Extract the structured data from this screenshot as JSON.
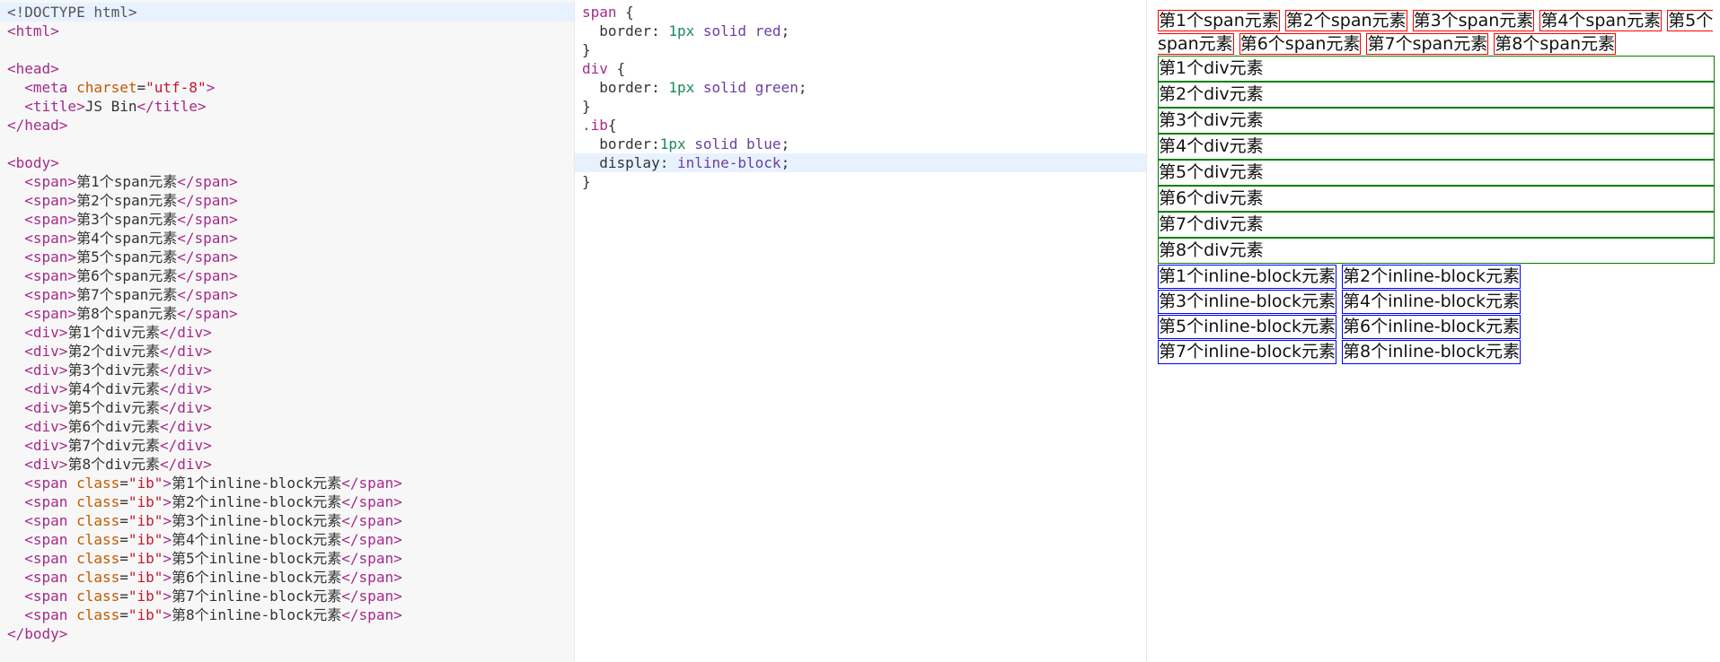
{
  "html_lines": [
    [
      [
        "c-doc",
        "<!DOCTYPE html>"
      ]
    ],
    [
      [
        "c-tag",
        "<html>"
      ]
    ],
    [],
    [
      [
        "c-tag",
        "<head>"
      ]
    ],
    [
      [
        "c-txt",
        "  "
      ],
      [
        "c-tag",
        "<meta "
      ],
      [
        "c-attr",
        "charset"
      ],
      [
        "c-txt",
        "="
      ],
      [
        "c-str",
        "\"utf-8\""
      ],
      [
        "c-tag",
        ">"
      ]
    ],
    [
      [
        "c-txt",
        "  "
      ],
      [
        "c-tag",
        "<title>"
      ],
      [
        "c-txt",
        "JS Bin"
      ],
      [
        "c-tag",
        "</title>"
      ]
    ],
    [
      [
        "c-tag",
        "</head>"
      ]
    ],
    [],
    [
      [
        "c-tag",
        "<body>"
      ]
    ],
    [
      [
        "c-txt",
        "  "
      ],
      [
        "c-tag",
        "<span>"
      ],
      [
        "c-txt",
        "第1个span元素"
      ],
      [
        "c-tag",
        "</span>"
      ]
    ],
    [
      [
        "c-txt",
        "  "
      ],
      [
        "c-tag",
        "<span>"
      ],
      [
        "c-txt",
        "第2个span元素"
      ],
      [
        "c-tag",
        "</span>"
      ]
    ],
    [
      [
        "c-txt",
        "  "
      ],
      [
        "c-tag",
        "<span>"
      ],
      [
        "c-txt",
        "第3个span元素"
      ],
      [
        "c-tag",
        "</span>"
      ]
    ],
    [
      [
        "c-txt",
        "  "
      ],
      [
        "c-tag",
        "<span>"
      ],
      [
        "c-txt",
        "第4个span元素"
      ],
      [
        "c-tag",
        "</span>"
      ]
    ],
    [
      [
        "c-txt",
        "  "
      ],
      [
        "c-tag",
        "<span>"
      ],
      [
        "c-txt",
        "第5个span元素"
      ],
      [
        "c-tag",
        "</span>"
      ]
    ],
    [
      [
        "c-txt",
        "  "
      ],
      [
        "c-tag",
        "<span>"
      ],
      [
        "c-txt",
        "第6个span元素"
      ],
      [
        "c-tag",
        "</span>"
      ]
    ],
    [
      [
        "c-txt",
        "  "
      ],
      [
        "c-tag",
        "<span>"
      ],
      [
        "c-txt",
        "第7个span元素"
      ],
      [
        "c-tag",
        "</span>"
      ]
    ],
    [
      [
        "c-txt",
        "  "
      ],
      [
        "c-tag",
        "<span>"
      ],
      [
        "c-txt",
        "第8个span元素"
      ],
      [
        "c-tag",
        "</span>"
      ]
    ],
    [
      [
        "c-txt",
        "  "
      ],
      [
        "c-tag",
        "<div>"
      ],
      [
        "c-txt",
        "第1个div元素"
      ],
      [
        "c-tag",
        "</div>"
      ]
    ],
    [
      [
        "c-txt",
        "  "
      ],
      [
        "c-tag",
        "<div>"
      ],
      [
        "c-txt",
        "第2个div元素"
      ],
      [
        "c-tag",
        "</div>"
      ]
    ],
    [
      [
        "c-txt",
        "  "
      ],
      [
        "c-tag",
        "<div>"
      ],
      [
        "c-txt",
        "第3个div元素"
      ],
      [
        "c-tag",
        "</div>"
      ]
    ],
    [
      [
        "c-txt",
        "  "
      ],
      [
        "c-tag",
        "<div>"
      ],
      [
        "c-txt",
        "第4个div元素"
      ],
      [
        "c-tag",
        "</div>"
      ]
    ],
    [
      [
        "c-txt",
        "  "
      ],
      [
        "c-tag",
        "<div>"
      ],
      [
        "c-txt",
        "第5个div元素"
      ],
      [
        "c-tag",
        "</div>"
      ]
    ],
    [
      [
        "c-txt",
        "  "
      ],
      [
        "c-tag",
        "<div>"
      ],
      [
        "c-txt",
        "第6个div元素"
      ],
      [
        "c-tag",
        "</div>"
      ]
    ],
    [
      [
        "c-txt",
        "  "
      ],
      [
        "c-tag",
        "<div>"
      ],
      [
        "c-txt",
        "第7个div元素"
      ],
      [
        "c-tag",
        "</div>"
      ]
    ],
    [
      [
        "c-txt",
        "  "
      ],
      [
        "c-tag",
        "<div>"
      ],
      [
        "c-txt",
        "第8个div元素"
      ],
      [
        "c-tag",
        "</div>"
      ]
    ],
    [
      [
        "c-txt",
        "  "
      ],
      [
        "c-tag",
        "<span "
      ],
      [
        "c-attr",
        "class"
      ],
      [
        "c-txt",
        "="
      ],
      [
        "c-str",
        "\"ib\""
      ],
      [
        "c-tag",
        ">"
      ],
      [
        "c-txt",
        "第1个inline-block元素"
      ],
      [
        "c-tag",
        "</span>"
      ]
    ],
    [
      [
        "c-txt",
        "  "
      ],
      [
        "c-tag",
        "<span "
      ],
      [
        "c-attr",
        "class"
      ],
      [
        "c-txt",
        "="
      ],
      [
        "c-str",
        "\"ib\""
      ],
      [
        "c-tag",
        ">"
      ],
      [
        "c-txt",
        "第2个inline-block元素"
      ],
      [
        "c-tag",
        "</span>"
      ]
    ],
    [
      [
        "c-txt",
        "  "
      ],
      [
        "c-tag",
        "<span "
      ],
      [
        "c-attr",
        "class"
      ],
      [
        "c-txt",
        "="
      ],
      [
        "c-str",
        "\"ib\""
      ],
      [
        "c-tag",
        ">"
      ],
      [
        "c-txt",
        "第3个inline-block元素"
      ],
      [
        "c-tag",
        "</span>"
      ]
    ],
    [
      [
        "c-txt",
        "  "
      ],
      [
        "c-tag",
        "<span "
      ],
      [
        "c-attr",
        "class"
      ],
      [
        "c-txt",
        "="
      ],
      [
        "c-str",
        "\"ib\""
      ],
      [
        "c-tag",
        ">"
      ],
      [
        "c-txt",
        "第4个inline-block元素"
      ],
      [
        "c-tag",
        "</span>"
      ]
    ],
    [
      [
        "c-txt",
        "  "
      ],
      [
        "c-tag",
        "<span "
      ],
      [
        "c-attr",
        "class"
      ],
      [
        "c-txt",
        "="
      ],
      [
        "c-str",
        "\"ib\""
      ],
      [
        "c-tag",
        ">"
      ],
      [
        "c-txt",
        "第5个inline-block元素"
      ],
      [
        "c-tag",
        "</span>"
      ]
    ],
    [
      [
        "c-txt",
        "  "
      ],
      [
        "c-tag",
        "<span "
      ],
      [
        "c-attr",
        "class"
      ],
      [
        "c-txt",
        "="
      ],
      [
        "c-str",
        "\"ib\""
      ],
      [
        "c-tag",
        ">"
      ],
      [
        "c-txt",
        "第6个inline-block元素"
      ],
      [
        "c-tag",
        "</span>"
      ]
    ],
    [
      [
        "c-txt",
        "  "
      ],
      [
        "c-tag",
        "<span "
      ],
      [
        "c-attr",
        "class"
      ],
      [
        "c-txt",
        "="
      ],
      [
        "c-str",
        "\"ib\""
      ],
      [
        "c-tag",
        ">"
      ],
      [
        "c-txt",
        "第7个inline-block元素"
      ],
      [
        "c-tag",
        "</span>"
      ]
    ],
    [
      [
        "c-txt",
        "  "
      ],
      [
        "c-tag",
        "<span "
      ],
      [
        "c-attr",
        "class"
      ],
      [
        "c-txt",
        "="
      ],
      [
        "c-str",
        "\"ib\""
      ],
      [
        "c-tag",
        ">"
      ],
      [
        "c-txt",
        "第8个inline-block元素"
      ],
      [
        "c-tag",
        "</span>"
      ]
    ],
    [
      [
        "c-tag",
        "</body>"
      ]
    ]
  ],
  "html_active_line": 0,
  "css_lines": [
    [
      [
        "c-sel",
        "span "
      ],
      [
        "c-brace",
        "{"
      ]
    ],
    [
      [
        "c-prop",
        "  border: "
      ],
      [
        "c-num",
        "1px "
      ],
      [
        "c-val",
        "solid red"
      ],
      [
        "c-prop",
        ";"
      ]
    ],
    [
      [
        "c-brace",
        "}"
      ]
    ],
    [
      [
        "c-sel",
        "div "
      ],
      [
        "c-brace",
        "{"
      ]
    ],
    [
      [
        "c-prop",
        "  border: "
      ],
      [
        "c-num",
        "1px "
      ],
      [
        "c-val",
        "solid green"
      ],
      [
        "c-prop",
        ";"
      ]
    ],
    [
      [
        "c-brace",
        "}"
      ]
    ],
    [
      [
        "c-sel",
        ".ib"
      ],
      [
        "c-brace",
        "{"
      ]
    ],
    [
      [
        "c-prop",
        "  border:"
      ],
      [
        "c-num",
        "1px "
      ],
      [
        "c-val",
        "solid blue"
      ],
      [
        "c-prop",
        ";"
      ]
    ],
    [
      [
        "c-prop",
        "  display: "
      ],
      [
        "c-val",
        "inline-block"
      ],
      [
        "c-prop",
        ";"
      ]
    ],
    [
      [
        "c-brace",
        "}"
      ]
    ]
  ],
  "css_active_line": 8,
  "output": {
    "spans": [
      "第1个span元素",
      "第2个span元素",
      "第3个span元素",
      "第4个span元素",
      "第5个span元素",
      "第6个span元素",
      "第7个span元素",
      "第8个span元素"
    ],
    "divs": [
      "第1个div元素",
      "第2个div元素",
      "第3个div元素",
      "第4个div元素",
      "第5个div元素",
      "第6个div元素",
      "第7个div元素",
      "第8个div元素"
    ],
    "inline_blocks": [
      "第1个inline-block元素",
      "第2个inline-block元素",
      "第3个inline-block元素",
      "第4个inline-block元素",
      "第5个inline-block元素",
      "第6个inline-block元素",
      "第7个inline-block元素",
      "第8个inline-block元素"
    ]
  },
  "colors": {
    "span_border": "#ff0000",
    "div_border": "#008000",
    "ib_border": "#0000ff"
  }
}
